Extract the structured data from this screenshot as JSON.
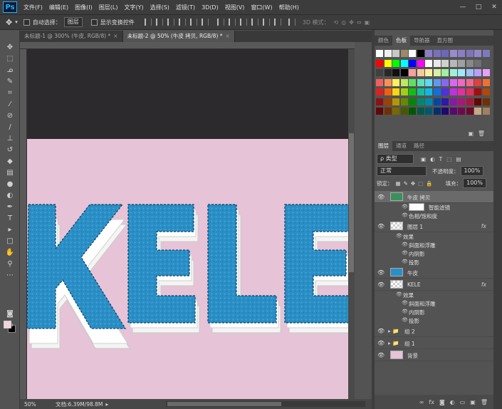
{
  "app": {
    "logo": "Ps"
  },
  "menu": [
    "文件(F)",
    "编辑(E)",
    "图像(I)",
    "图层(L)",
    "文字(Y)",
    "选择(S)",
    "滤镜(T)",
    "3D(D)",
    "视图(V)",
    "窗口(W)",
    "帮助(H)"
  ],
  "window_controls": [
    "—",
    "□",
    "✕"
  ],
  "options": {
    "auto_select_label": "自动选择：",
    "auto_select_value": "图层",
    "show_transform_label": "显示变换控件",
    "mode_3d_label": "3D 模式："
  },
  "tabs": [
    {
      "label": "未标题-1 @ 300% (牛皮, RGB/8) *",
      "close": "×"
    },
    {
      "label": "未标题-2 @ 50% (牛皮 拷贝, RGB/8) *",
      "close": "×"
    }
  ],
  "ruler_labels_top": [
    "2",
    "4"
  ],
  "status": {
    "zoom": "50%",
    "doc_info": "文档:6.39M/98.8M"
  },
  "canvas": {
    "text": "KELE",
    "bg_color": "#e6c3d6",
    "dark_band": "#2c2a2c",
    "letter_color": "#2a8fc6"
  },
  "swatch_panel": {
    "tabs": [
      "颜色",
      "色板",
      "导航器",
      "直方图"
    ],
    "active_tab": "色板"
  },
  "layers_panel": {
    "tabs": [
      "图层",
      "通道",
      "路径"
    ],
    "active_tab": "图层",
    "filter_label": "ρ 类型",
    "blend_mode": "正常",
    "opacity_label": "不透明度：",
    "opacity_value": "100%",
    "lock_label": "锁定：",
    "fill_label": "填充：",
    "fill_value": "100%",
    "layers": [
      {
        "name": "牛皮 拷贝",
        "kind": "smart",
        "selected": true
      },
      {
        "name": "智能滤镜",
        "kind": "sub",
        "indent": 2
      },
      {
        "name": "色相/饱和度",
        "kind": "sub",
        "indent": 2
      },
      {
        "name": "图层 1",
        "kind": "layer",
        "fx": "fx"
      },
      {
        "name": "效果",
        "kind": "sub",
        "indent": 1
      },
      {
        "name": "斜面和浮雕",
        "kind": "sub",
        "indent": 2
      },
      {
        "name": "内阴影",
        "kind": "sub",
        "indent": 2
      },
      {
        "name": "投影",
        "kind": "sub",
        "indent": 2
      },
      {
        "name": "牛皮",
        "kind": "layer"
      },
      {
        "name": "KELE",
        "kind": "layer",
        "fx": "fx"
      },
      {
        "name": "效果",
        "kind": "sub",
        "indent": 1
      },
      {
        "name": "斜面和浮雕",
        "kind": "sub",
        "indent": 2
      },
      {
        "name": "内阴影",
        "kind": "sub",
        "indent": 2
      },
      {
        "name": "投影",
        "kind": "sub",
        "indent": 2
      },
      {
        "name": "组 2",
        "kind": "group"
      },
      {
        "name": "组 1",
        "kind": "group"
      },
      {
        "name": "背景",
        "kind": "background"
      }
    ]
  }
}
